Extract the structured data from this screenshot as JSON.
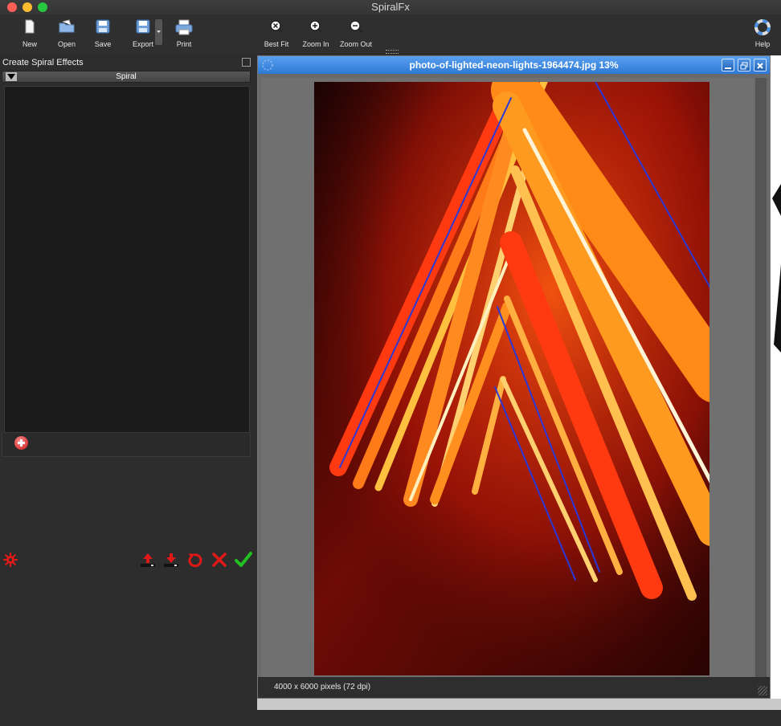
{
  "app": {
    "title": "SpiralFx"
  },
  "toolbar": {
    "new_label": "New",
    "open_label": "Open",
    "save_label": "Save",
    "export_label": "Export",
    "print_label": "Print",
    "bestfit_label": "Best Fit",
    "zoomin_label": "Zoom In",
    "zoomout_label": "Zoom Out",
    "help_label": "Help"
  },
  "panel": {
    "title": "Create Spiral Effects",
    "accordion_label": "Spiral"
  },
  "document": {
    "title": "photo-of-lighted-neon-lights-1964474.jpg 13%",
    "status": "4000 x 6000 pixels (72 dpi)"
  },
  "colors": {
    "traffic_close": "#fe5f57",
    "traffic_min": "#febc2e",
    "traffic_max": "#28c840",
    "accent_red": "#e02020",
    "accent_green": "#22c022"
  },
  "icons": [
    "new-icon",
    "open-icon",
    "save-icon",
    "export-icon",
    "print-icon",
    "best-fit-icon",
    "zoom-in-icon",
    "zoom-out-icon",
    "help-icon",
    "plus-icon",
    "gear-icon",
    "upload-icon",
    "download-icon",
    "reset-icon",
    "cancel-icon",
    "apply-icon"
  ]
}
